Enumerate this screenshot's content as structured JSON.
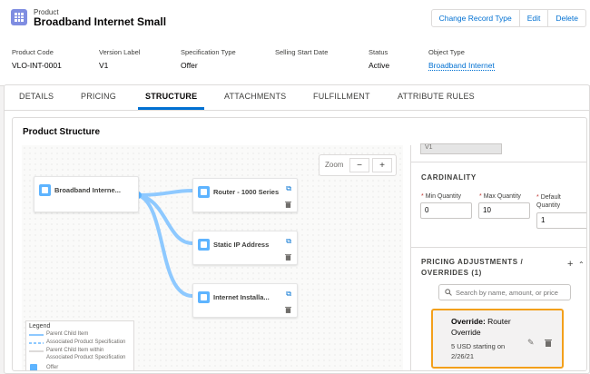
{
  "header": {
    "entity_label": "Product",
    "record_name": "Broadband Internet Small",
    "buttons": {
      "change_record_type": "Change Record Type",
      "edit": "Edit",
      "delete": "Delete"
    }
  },
  "highlights": [
    {
      "label": "Product Code",
      "value": "VLO-INT-0001"
    },
    {
      "label": "Version Label",
      "value": "V1"
    },
    {
      "label": "Specification Type",
      "value": "Offer"
    },
    {
      "label": "Selling Start Date",
      "value": ""
    },
    {
      "label": "Status",
      "value": "Active"
    },
    {
      "label": "Object Type",
      "value": "Broadband Internet"
    }
  ],
  "tabs": [
    "DETAILS",
    "PRICING",
    "STRUCTURE",
    "ATTACHMENTS",
    "FULFILLMENT",
    "ATTRIBUTE RULES"
  ],
  "active_tab": "STRUCTURE",
  "structure": {
    "title": "Product Structure",
    "zoom": {
      "label": "Zoom",
      "minus": "−",
      "plus": "+"
    },
    "root_node": "Broadband Interne...",
    "child_nodes": [
      "Router - 1000 Series",
      "Static IP Address",
      "Internet Installa..."
    ],
    "legend": {
      "title": "Legend",
      "items": [
        "Parent Child Item",
        "Associated Product Specification",
        "Parent Child Item within",
        "Associated Product Specification",
        "Offer"
      ]
    }
  },
  "side_panel": {
    "version_value": "V1",
    "cardinality": {
      "title": "CARDINALITY",
      "min_label": "Min Quantity",
      "min_value": "0",
      "max_label": "Max Quantity",
      "max_value": "10",
      "default_label_1": "Default",
      "default_label_2": "Quantity",
      "default_value": "1",
      "required_marker": "*"
    },
    "pricing": {
      "title_line1": "PRICING ADJUSTMENTS /",
      "title_line2": "OVERRIDES (1)",
      "add_icon": "+",
      "collapse_icon": "⌃",
      "search_placeholder": "Search by name, amount, or price",
      "override": {
        "title_bold": "Override:",
        "title_rest": " Router Override",
        "subtitle": "5 USD starting on 2/26/21"
      }
    }
  },
  "colors": {
    "accent": "#0070d2",
    "node_icon": "#5eb4ff",
    "connector": "#8ec9ff",
    "highlight_border": "#f3a01b",
    "object_icon": "#7f8de1"
  }
}
